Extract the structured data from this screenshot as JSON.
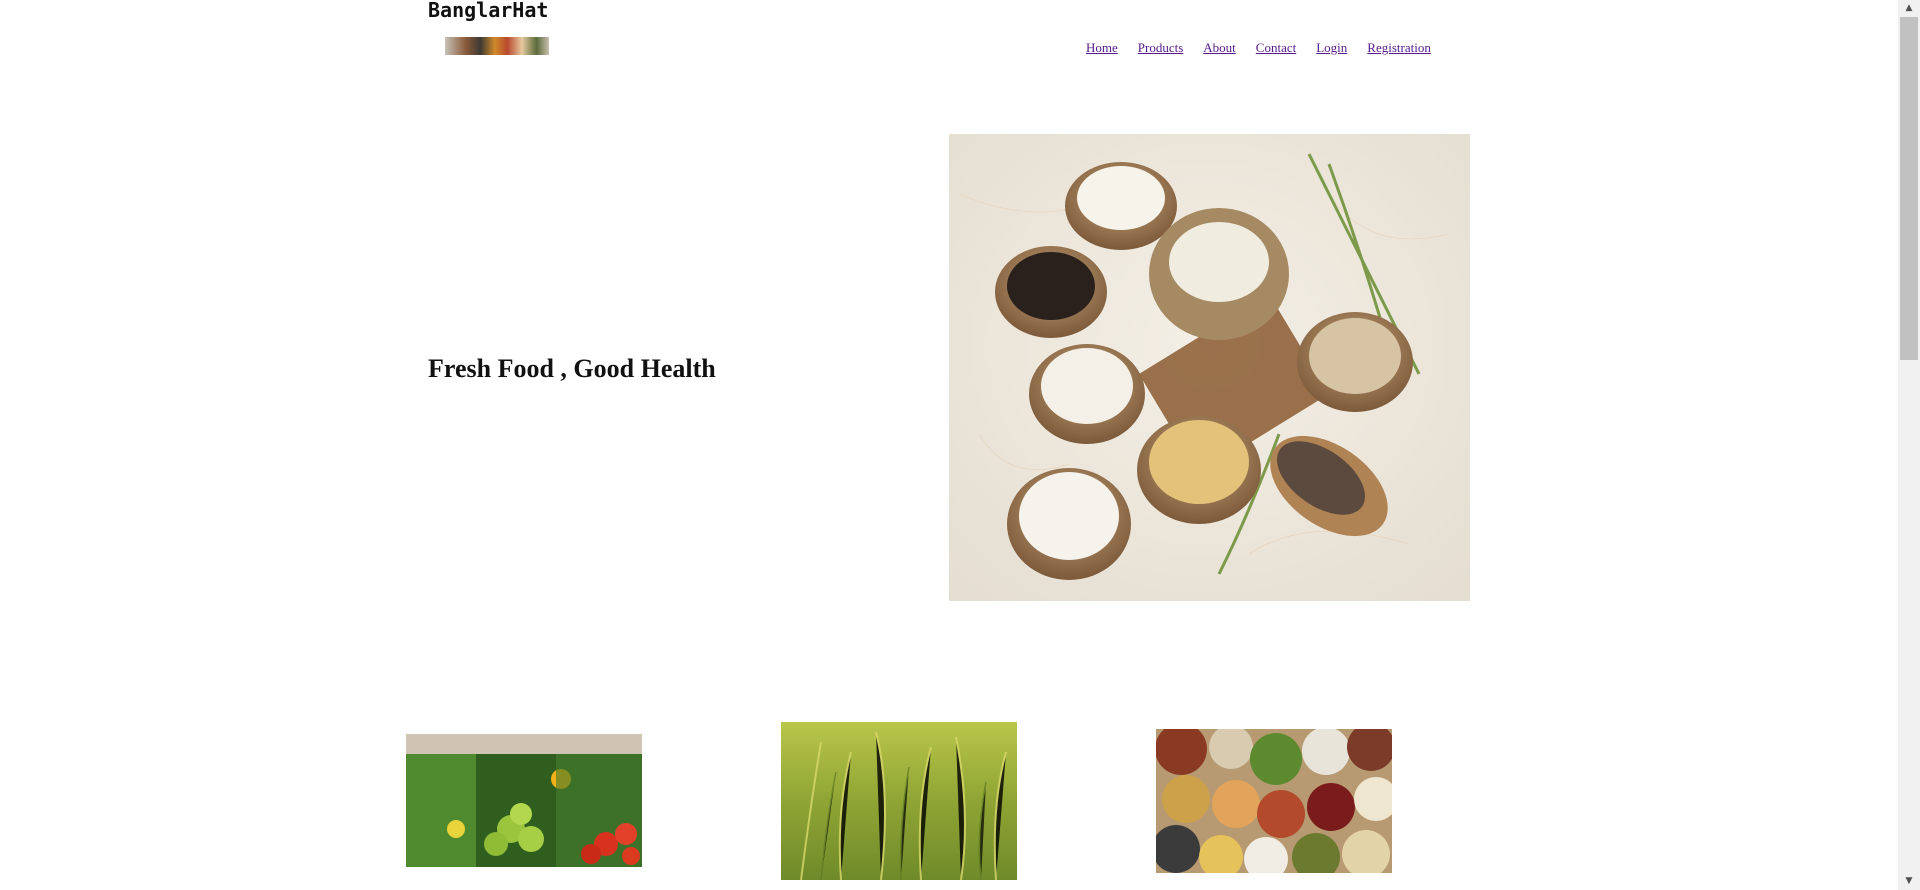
{
  "header": {
    "brand": "BanglarHat"
  },
  "nav": {
    "items": [
      "Home",
      "Products",
      "About",
      "Contact",
      "Login",
      "Registration"
    ]
  },
  "hero": {
    "tagline": "Fresh Food , Good Health"
  },
  "colors": {
    "link": "#551a8b",
    "text": "#111111",
    "background": "#ffffff"
  }
}
